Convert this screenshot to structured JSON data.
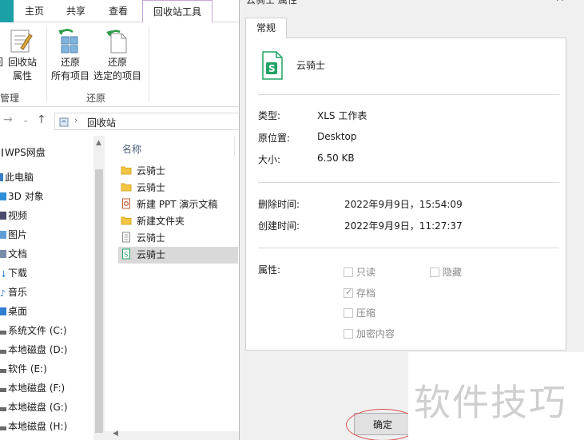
{
  "ribbon": {
    "tabs": [
      "主页",
      "共享",
      "查看",
      "回收站工具"
    ],
    "buttons": {
      "restore_props": {
        "line1": "回收站",
        "line2": "属性"
      },
      "restore_all": {
        "line1": "还原",
        "line2": "所有项目"
      },
      "restore_selected": {
        "line1": "还原",
        "line2": "选定的项目"
      }
    },
    "groups": {
      "manage": "管理",
      "restore": "还原"
    }
  },
  "address": {
    "location": "回收站"
  },
  "nav": {
    "items": [
      "WPS网盘",
      "此电脑",
      "3D 对象",
      "视频",
      "图片",
      "文档",
      "下载",
      "音乐",
      "桌面",
      "系统文件 (C:)",
      "本地磁盘 (D:)",
      "软件 (E:)",
      "本地磁盘 (F:)",
      "本地磁盘 (G:)",
      "本地磁盘 (H:)"
    ]
  },
  "files": {
    "column_name": "名称",
    "rows": [
      "云骑士",
      "云骑士",
      "新建 PPT 演示文稿",
      "新建文件夹",
      "云骑士",
      "云骑士"
    ]
  },
  "dialog": {
    "title": "云骑士 属性",
    "tab": "常规",
    "filename": "云骑士",
    "fields": {
      "type_label": "类型:",
      "type_value": "XLS 工作表",
      "origin_label": "原位置:",
      "origin_value": "Desktop",
      "size_label": "大小:",
      "size_value": "6.50 KB",
      "deleted_label": "删除时间:",
      "deleted_value": "2022年9月9日，15:54:09",
      "created_label": "创建时间:",
      "created_value": "2022年9月9日，11:27:37",
      "attr_label": "属性:"
    },
    "attributes": {
      "readonly": "只读",
      "hidden": "隐藏",
      "archive": "存档",
      "compress": "压缩",
      "encrypt": "加密内容"
    },
    "ok_label": "确定"
  },
  "watermark": "软件技巧",
  "colors": {
    "accent_teal": "#1aa0a6",
    "excel_green": "#21a366",
    "folder_yellow": "#f4c542",
    "highlight_red": "#d9534f"
  }
}
